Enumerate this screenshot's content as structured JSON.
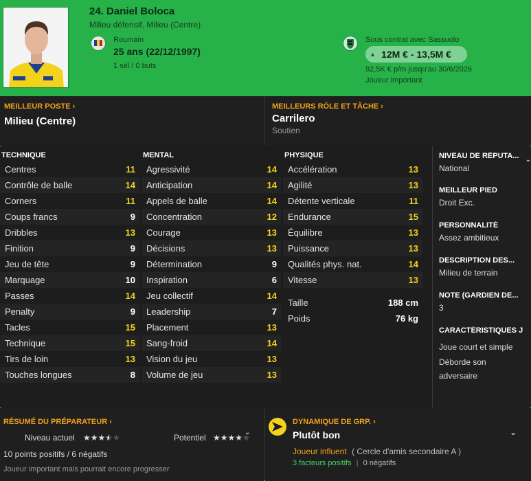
{
  "header": {
    "name": "24. Daniel Boloca",
    "position": "Milieu défensif, Milieu (Centre)",
    "nationality": "Roumain",
    "age": "25 ans (22/12/1997)",
    "caps": "1 sél / 0 buts",
    "contract": "Sous contrat avec Sassuolo",
    "value": "12M € - 13,5M €",
    "wage": "92,5K € p/m jusqu'au 30/6/2026",
    "status": "Joueur important"
  },
  "best_position": {
    "title": "MEILLEUR POSTE",
    "value": "Milieu (Centre)"
  },
  "best_role": {
    "title": "MEILLEURS RÔLE ET TÂCHE",
    "value": "Carrilero",
    "duty": "Soutien"
  },
  "technical": {
    "title": "TECHNIQUE",
    "rows": [
      {
        "label": "Centres",
        "value": "11"
      },
      {
        "label": "Contrôle de balle",
        "value": "14"
      },
      {
        "label": "Corners",
        "value": "11"
      },
      {
        "label": "Coups francs",
        "value": "9"
      },
      {
        "label": "Dribbles",
        "value": "13"
      },
      {
        "label": "Finition",
        "value": "9"
      },
      {
        "label": "Jeu de tête",
        "value": "9"
      },
      {
        "label": "Marquage",
        "value": "10"
      },
      {
        "label": "Passes",
        "value": "14"
      },
      {
        "label": "Penalty",
        "value": "9"
      },
      {
        "label": "Tacles",
        "value": "15"
      },
      {
        "label": "Technique",
        "value": "15"
      },
      {
        "label": "Tirs de loin",
        "value": "13"
      },
      {
        "label": "Touches longues",
        "value": "8"
      }
    ]
  },
  "mental": {
    "title": "MENTAL",
    "rows": [
      {
        "label": "Agressivité",
        "value": "14"
      },
      {
        "label": "Anticipation",
        "value": "14"
      },
      {
        "label": "Appels de balle",
        "value": "14"
      },
      {
        "label": "Concentration",
        "value": "12"
      },
      {
        "label": "Courage",
        "value": "13"
      },
      {
        "label": "Décisions",
        "value": "13"
      },
      {
        "label": "Détermination",
        "value": "9"
      },
      {
        "label": "Inspiration",
        "value": "6"
      },
      {
        "label": "Jeu collectif",
        "value": "14"
      },
      {
        "label": "Leadership",
        "value": "7"
      },
      {
        "label": "Placement",
        "value": "13"
      },
      {
        "label": "Sang-froid",
        "value": "14"
      },
      {
        "label": "Vision du jeu",
        "value": "13"
      },
      {
        "label": "Volume de jeu",
        "value": "13"
      }
    ]
  },
  "physical": {
    "title": "PHYSIQUE",
    "rows": [
      {
        "label": "Accélération",
        "value": "13"
      },
      {
        "label": "Agilité",
        "value": "13"
      },
      {
        "label": "Détente verticale",
        "value": "11"
      },
      {
        "label": "Endurance",
        "value": "15"
      },
      {
        "label": "Équilibre",
        "value": "13"
      },
      {
        "label": "Puissance",
        "value": "13"
      },
      {
        "label": "Qualités phys. nat.",
        "value": "14"
      },
      {
        "label": "Vitesse",
        "value": "13"
      }
    ],
    "height_label": "Taille",
    "height": "188 cm",
    "weight_label": "Poids",
    "weight": "76 kg"
  },
  "side": {
    "reputation_title": "NIVEAU DE RÉPUTA...",
    "reputation": "National",
    "foot_title": "MEILLEUR PIED",
    "foot": "Droit Exc.",
    "personality_title": "PERSONNALITÉ",
    "personality": "Assez ambitieux",
    "description_title": "DESCRIPTION DES...",
    "description": "Milieu de terrain",
    "gk_title": "NOTE (GARDIEN DE...",
    "gk": "3",
    "traits_title": "CARACTÉRISTIQUES J",
    "trait1": "Joue court et simple",
    "trait2": "Déborde son adversaire"
  },
  "coach": {
    "title": "RÉSUMÉ DU PRÉPARATEUR",
    "current_label": "Niveau actuel",
    "current_stars": 3.5,
    "potential_label": "Potentiel",
    "potential_stars": 4,
    "points": "10 points positifs / 6 négatifs",
    "note": "Joueur important mais pourrait encore progresser"
  },
  "dynamics": {
    "title": "DYNAMIQUE DE GRP.",
    "value": "Plutôt bon",
    "influence": "Joueur influent",
    "circle": "( Cercle d'amis secondaire A )",
    "positives": "3 facteurs positifs",
    "negatives": "0 négatifs"
  },
  "colors": {
    "header_green": "#27b149",
    "accent_orange": "#f3a21b",
    "attr_yellow": "#f3d21e"
  }
}
